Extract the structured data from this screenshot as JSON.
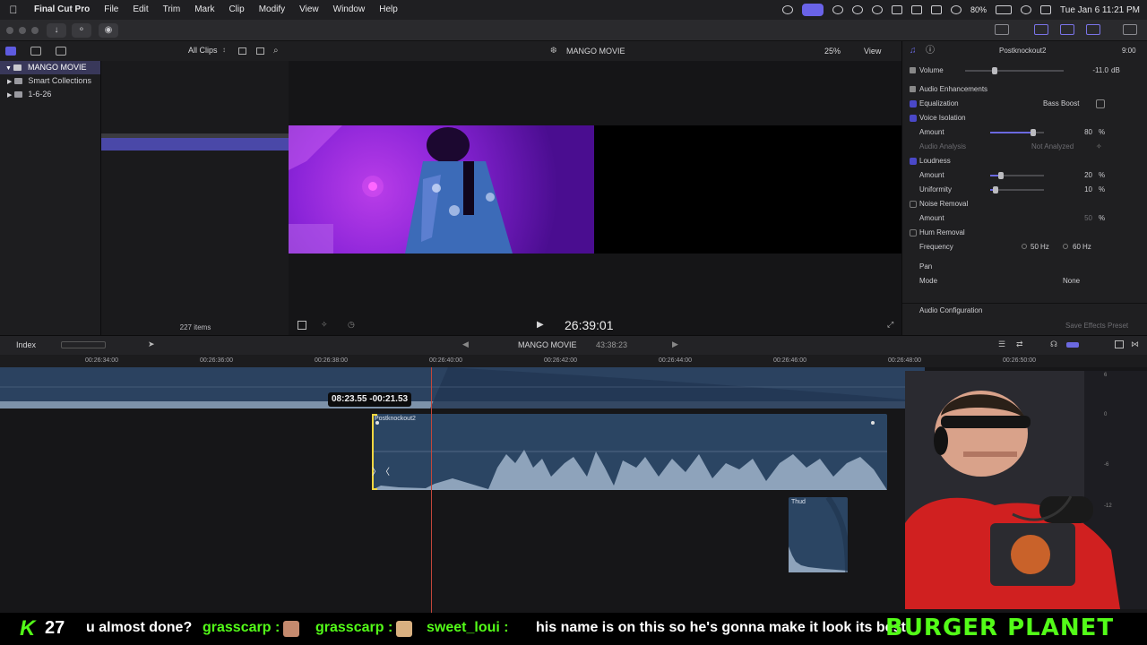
{
  "menubar": {
    "app_name": "Final Cut Pro",
    "items": [
      "File",
      "Edit",
      "Trim",
      "Mark",
      "Clip",
      "Modify",
      "View",
      "Window",
      "Help"
    ],
    "battery": "80%",
    "datetime": "Tue Jan 6  11:21 PM"
  },
  "browser": {
    "filter": "All Clips",
    "library_name": "MANGO MOVIE",
    "rows": [
      "Smart Collections",
      "1-6-26"
    ],
    "items_count": "227 items"
  },
  "viewer": {
    "title": "MANGO MOVIE",
    "zoom": "25%",
    "view_label": "View",
    "timecode": "26:39:01"
  },
  "inspector": {
    "clip_name": "Postknockout2",
    "clip_duration": "9:00",
    "volume_label": "Volume",
    "volume_value": "-11.0",
    "volume_unit": "dB",
    "enhancements_title": "Audio Enhancements",
    "equalization_label": "Equalization",
    "equalization_value": "Bass Boost",
    "voice_isolation_label": "Voice Isolation",
    "vi_amount_label": "Amount",
    "vi_amount_value": "80",
    "vi_amount_unit": "%",
    "analysis_label": "Audio Analysis",
    "analysis_value": "Not Analyzed",
    "loudness_label": "Loudness",
    "loud_amount_label": "Amount",
    "loud_amount_value": "20",
    "loud_amount_unit": "%",
    "uniformity_label": "Uniformity",
    "uniformity_value": "10",
    "uniformity_unit": "%",
    "noise_label": "Noise Removal",
    "noise_amount_label": "Amount",
    "noise_amount_value": "50",
    "noise_amount_unit": "%",
    "hum_label": "Hum Removal",
    "frequency_label": "Frequency",
    "freq_50": "50",
    "freq_60": "60",
    "freq_unit": "Hz",
    "pan_label": "Pan",
    "mode_label": "Mode",
    "mode_value": "None",
    "config_label": "Audio Configuration",
    "save_preset": "Save Effects Preset",
    "levels": {
      "volume": 0.3,
      "vi_amount": 0.8,
      "loud_amount": 0.2,
      "uniformity": 0.1
    }
  },
  "timeline": {
    "index_label": "Index",
    "project": "MANGO MOVIE",
    "duration": "43:38:23",
    "ruler": [
      "00:26:34:00",
      "00:26:36:00",
      "00:26:38:00",
      "00:26:40:00",
      "00:26:42:00",
      "00:26:44:00",
      "00:26:46:00",
      "00:26:48:00",
      "00:26:50:00"
    ],
    "trim_tooltip": "08:23.55  -00:21.53",
    "clip_main": "Postknockout2",
    "clip_thud": "Thud"
  },
  "ticker": {
    "kick": "27",
    "msg1": "u almost done?",
    "user1": "grasscarp :",
    "user2": "grasscarp :",
    "user3": "sweet_loui :",
    "msg3": "his name is on this so he's gonna make it look its best",
    "brand": "BURGER PLANET"
  },
  "meter_labels": [
    "6",
    "0",
    "-6",
    "-12"
  ]
}
